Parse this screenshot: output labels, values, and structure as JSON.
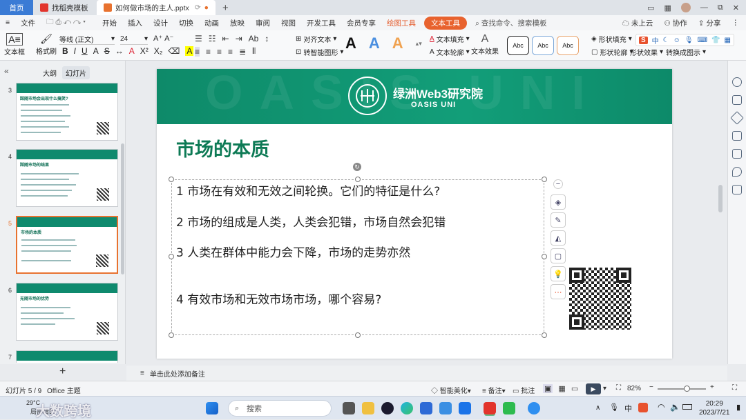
{
  "titlebar": {
    "home_tab": "首页",
    "template_tab": "找稻壳模板",
    "file_tab": "如何做市场的主人.pptx",
    "window_controls": [
      "□",
      "—",
      "⧉",
      "✕"
    ]
  },
  "menubar": {
    "file": "文件",
    "items": [
      "开始",
      "插入",
      "设计",
      "切换",
      "动画",
      "放映",
      "审阅",
      "视图",
      "开发工具",
      "会员专享"
    ],
    "draw_tool": "绘图工具",
    "text_tool": "文本工具",
    "search": "查找命令、搜索模板",
    "cloud": "未上云",
    "collab": "协作",
    "share": "分享"
  },
  "ribbon": {
    "textbox": "文本框",
    "format_painter": "格式刷",
    "font_name": "等线 (正文)",
    "font_size": "24",
    "align_text": "对齐文本",
    "smart_art": "转智能图形",
    "text_fill": "文本填充",
    "text_outline": "文本轮廓",
    "text_effect": "文本效果",
    "style_sample": "Abc",
    "shape_fill": "形状填充",
    "shape_outline": "形状轮廓",
    "shape_effect": "形状效果",
    "convert_chart": "转换成图示",
    "accent_orange": "#e8622e",
    "accent_blue": "#3a7bd5"
  },
  "leftpanel": {
    "tab_outline": "大纲",
    "tab_slides": "幻灯片",
    "thumbs": [
      {
        "num": "3",
        "title": "踩随市场会出现什么搞笑?"
      },
      {
        "num": "4",
        "title": "踩随市场的结果"
      },
      {
        "num": "5",
        "title": "市场的本质"
      },
      {
        "num": "6",
        "title": "无随市场的优势"
      },
      {
        "num": "7",
        "title": ""
      }
    ],
    "add": "+"
  },
  "slide": {
    "watermark": "OASIS UNI",
    "brand": "绿洲Web3研究院",
    "brand_sub": "OASIS UNI",
    "title": "市场的本质",
    "bullets": [
      "1 市场在有效和无效之间轮换。它们的特征是什么?",
      "2 市场的组成是人类，人类会犯错，市场自然会犯错",
      "3 人类在群体中能力会下降，市场的走势亦然",
      "4 有效市场和无效市场市场，哪个容易?"
    ],
    "brand_color": "#0f8a6e",
    "title_color": "#0d7a55"
  },
  "notes": {
    "placeholder": "单击此处添加备注"
  },
  "status": {
    "slide_count": "幻灯片 5 / 9",
    "theme": "Office 主题",
    "beautify": "智能美化",
    "notes": "备注",
    "comments": "批注",
    "zoom": "82%"
  },
  "taskbar": {
    "search": "搜索",
    "weather": "29°C",
    "weather_desc": "局部晴朗",
    "time": "20:29",
    "date": "2023/7/21",
    "watermark": "大数跨境",
    "lang": "中"
  }
}
